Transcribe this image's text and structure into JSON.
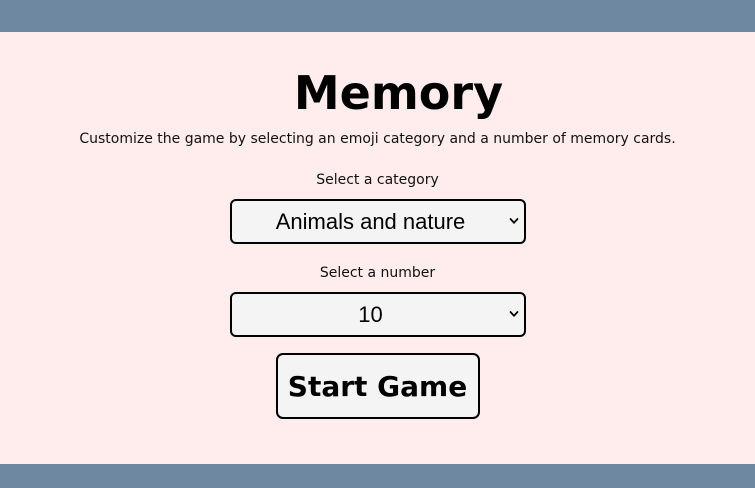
{
  "header": {
    "bar_color": "#6e88a2"
  },
  "page": {
    "background": "#ffeced",
    "title": "Memory",
    "intro": "Customize the game by selecting an emoji category and a number of memory cards."
  },
  "category": {
    "label": "Select a category",
    "selected": "Animals and nature",
    "icon": "chevron-down-icon"
  },
  "number": {
    "label": "Select a number",
    "selected": "10",
    "icon": "chevron-down-icon"
  },
  "start_button": {
    "label": "Start Game"
  },
  "footer": {
    "bar_color": "#6e88a2"
  }
}
